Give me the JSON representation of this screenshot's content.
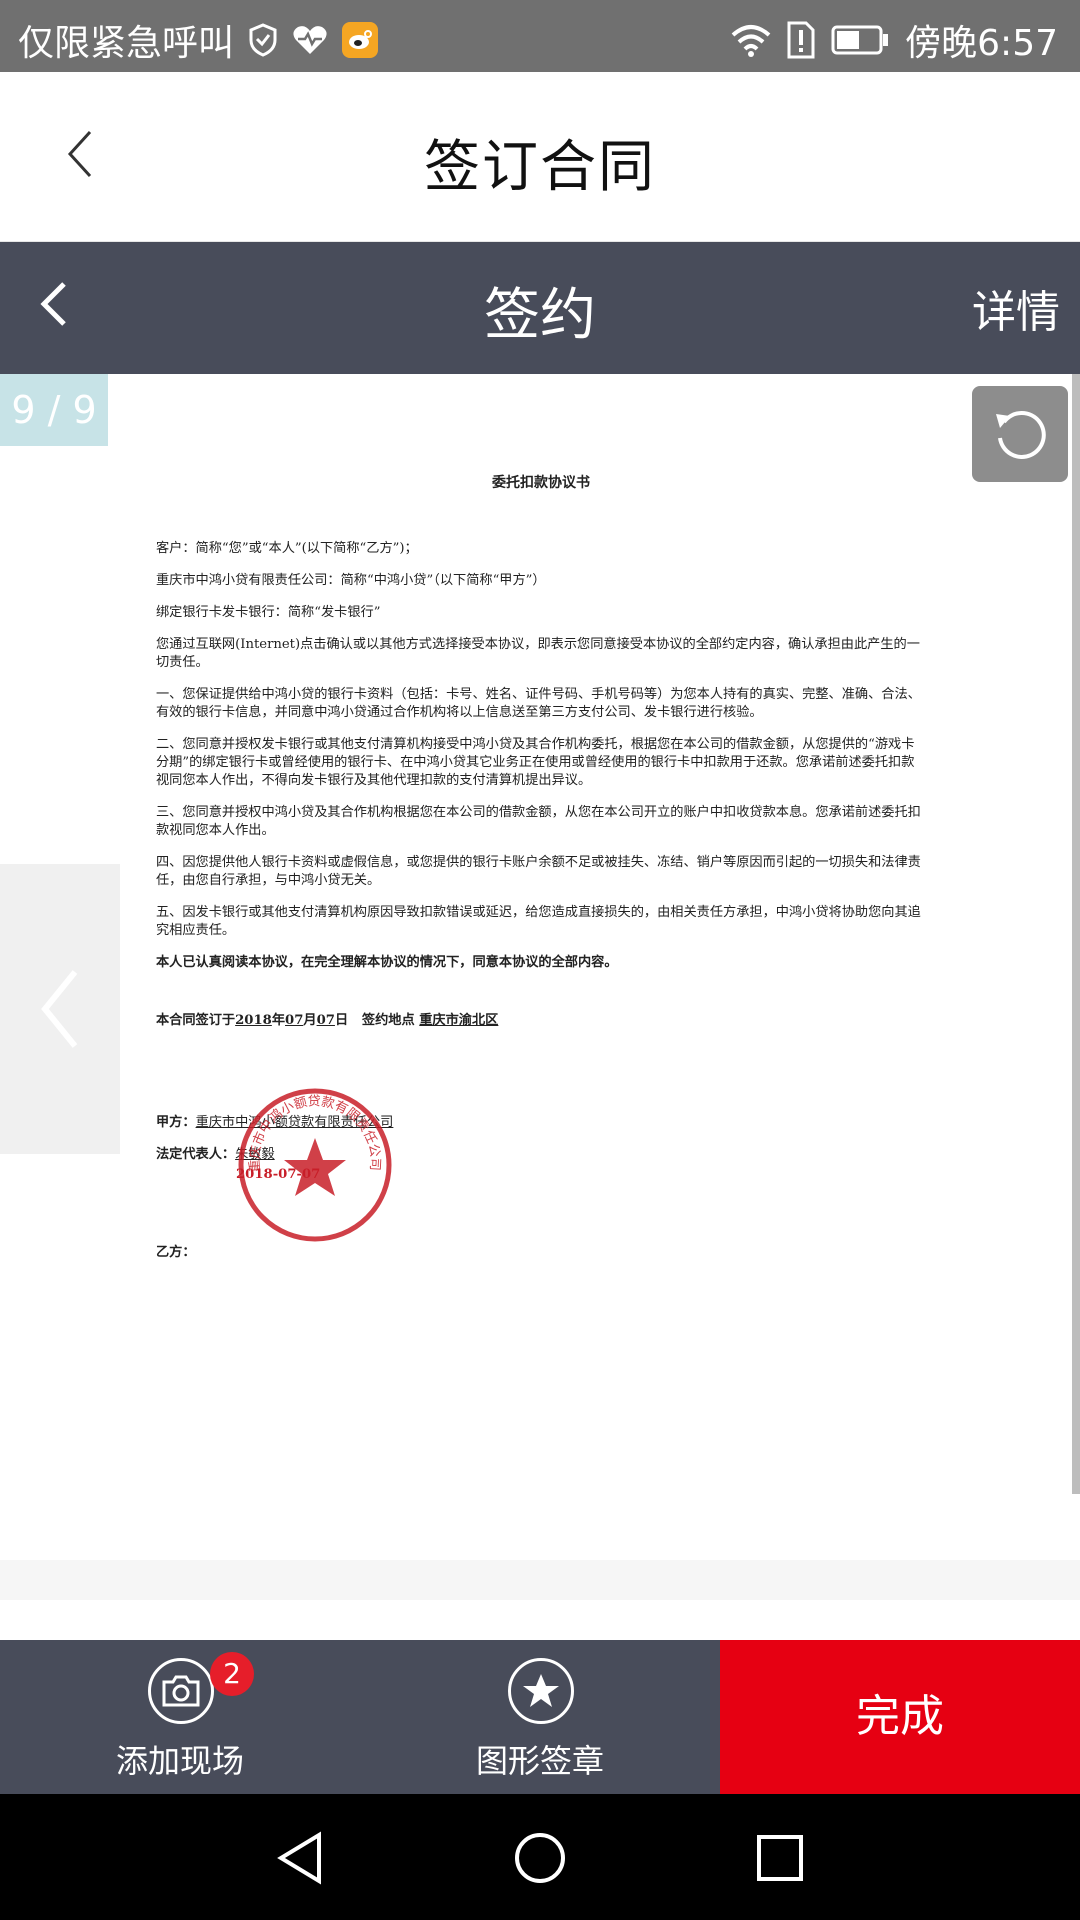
{
  "status_bar": {
    "carrier": "仅限紧急呼叫",
    "time": "傍晚6:57",
    "icons": [
      "vpn-shield-icon",
      "health-heart-icon",
      "weibo-app-icon",
      "wifi-icon",
      "sim-alert-icon",
      "battery-icon"
    ]
  },
  "header": {
    "title": "签订合同",
    "back_icon": "chevron-left-icon"
  },
  "sign_bar": {
    "title": "签约",
    "detail_label": "详情",
    "back_icon": "chevron-left-icon"
  },
  "viewer": {
    "page_indicator": "9 / 9",
    "rotate_icon": "rotate-icon",
    "prev_icon": "chevron-left-icon"
  },
  "document": {
    "title": "委托扣款协议书",
    "para_customer": "客户：简称“您”或“本人”(以下简称“乙方”)；",
    "para_company": "重庆市中鸿小贷有限责任公司：简称“中鸿小贷”（以下简称“甲方”）",
    "para_bank": "绑定银行卡发卡银行：简称“发卡银行”",
    "para_intro": "您通过互联网(Internet)点击确认或以其他方式选择接受本协议，即表示您同意接受本协议的全部约定内容，确认承担由此产生的一切责任。",
    "clause_1": "一、您保证提供给中鸿小贷的银行卡资料（包括：卡号、姓名、证件号码、手机号码等）为您本人持有的真实、完整、准确、合法、有效的银行卡信息，并同意中鸿小贷通过合作机构将以上信息送至第三方支付公司、发卡银行进行核验。",
    "clause_2": "二、您同意并授权发卡银行或其他支付清算机构接受中鸿小贷及其合作机构委托，根据您在本公司的借款金额，从您提供的“游戏卡分期”的绑定银行卡或曾经使用的银行卡、在中鸿小贷其它业务正在使用或曾经使用的银行卡中扣款用于还款。您承诺前述委托扣款视同您本人作出，不得向发卡银行及其他代理扣款的支付清算机提出异议。",
    "clause_3": "三、您同意并授权中鸿小贷及其合作机构根据您在本公司的借款金额，从您在本公司开立的账户中扣收贷款本息。您承诺前述委托扣款视同您本人作出。",
    "clause_4": "四、因您提供他人银行卡资料或虚假信息，或您提供的银行卡账户余额不足或被挂失、冻结、销户等原因而引起的一切损失和法律责任，由您自行承担，与中鸿小贷无关。",
    "clause_5": "五、因发卡银行或其他支付清算机构原因导致扣款错误或延迟，给您造成直接损失的，由相关责任方承担，中鸿小贷将协助您向其追究相应责任。",
    "confirm": "本人已认真阅读本协议，在完全理解本协议的情况下，同意本协议的全部内容。",
    "sign_date_label": "本合同签订于",
    "sign_year": "2018",
    "sign_month": "07",
    "sign_day": "07",
    "year_unit": "年",
    "month_unit": "月",
    "day_unit": "日",
    "sign_place_label": "签约地点",
    "sign_place": "重庆市渝北区",
    "party_a_label": "甲方：",
    "party_a": "重庆市中鸿小额贷款有限责任公司",
    "rep_label": "法定代表人：",
    "rep_name": "朱敏毅",
    "stamp_date": "2018-07-07",
    "party_b_label": "乙方：",
    "seal_text": "重庆市中鸿小额贷款有限责任公司"
  },
  "toolbar": {
    "add_scene_label": "添加现场",
    "add_scene_badge": "2",
    "seal_label": "图形签章",
    "done_label": "完成"
  },
  "nav": {
    "back_icon": "nav-back-icon",
    "home_icon": "nav-home-icon",
    "recents_icon": "nav-recents-icon"
  },
  "colors": {
    "dark_bar": "#484c5a",
    "done_red": "#e60012",
    "badge_red": "#e61e2a",
    "seal_red": "#c81e28",
    "page_indicator_bg": "#c7e3e7"
  }
}
